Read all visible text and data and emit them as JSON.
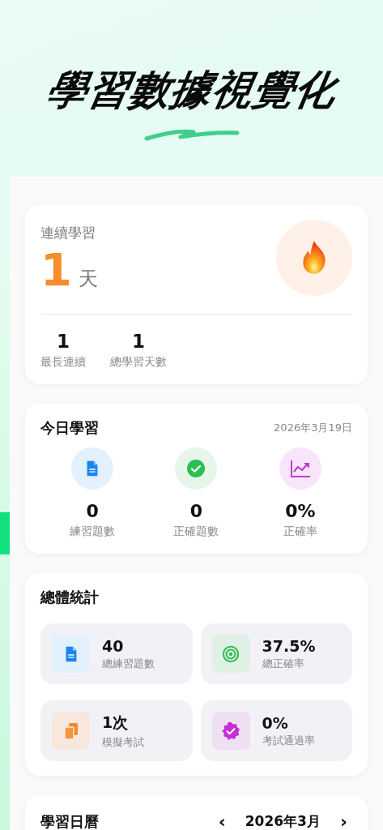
{
  "header": {
    "title": "學習數據視覺化"
  },
  "streak": {
    "label": "連續學習",
    "value": "1",
    "unit": "天",
    "stats": [
      {
        "value": "1",
        "label": "最長連續"
      },
      {
        "value": "1",
        "label": "總學習天數"
      }
    ]
  },
  "today": {
    "title": "今日學習",
    "date": "2026年3月19日",
    "stats": [
      {
        "kind": "document",
        "value": "0",
        "label": "練習題數"
      },
      {
        "kind": "check",
        "value": "0",
        "label": "正確題數"
      },
      {
        "kind": "trend",
        "value": "0%",
        "label": "正確率"
      }
    ]
  },
  "overall": {
    "title": "總體統計",
    "tiles": [
      {
        "kind": "document",
        "value": "40",
        "label": "總練習題數"
      },
      {
        "kind": "target",
        "value": "37.5%",
        "label": "總正確率"
      },
      {
        "kind": "copies",
        "value": "1次",
        "label": "模擬考試"
      },
      {
        "kind": "badge",
        "value": "0%",
        "label": "考試通過率"
      }
    ]
  },
  "calendar": {
    "title": "學習日曆",
    "prev": "‹",
    "month": "2026年3月",
    "next": "›"
  }
}
